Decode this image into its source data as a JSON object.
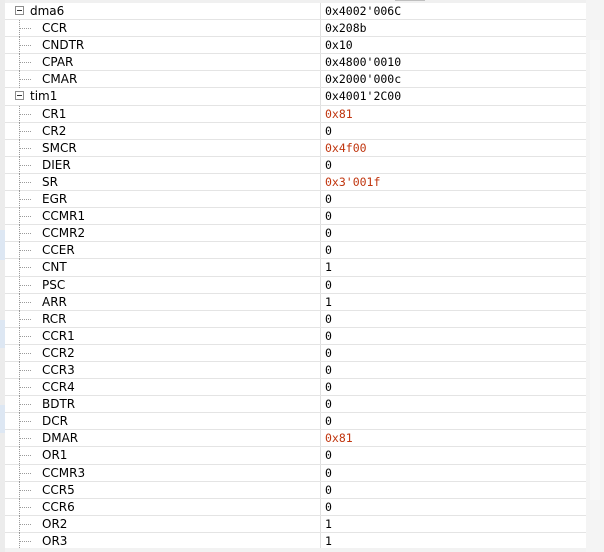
{
  "groups": [
    {
      "name": "dma6",
      "value": "0x4002'006C",
      "registers": [
        {
          "name": "CCR",
          "value": "0x208b",
          "changed": false
        },
        {
          "name": "CNDTR",
          "value": "0x10",
          "changed": false
        },
        {
          "name": "CPAR",
          "value": "0x4800'0010",
          "changed": false
        },
        {
          "name": "CMAR",
          "value": "0x2000'000c",
          "changed": false
        }
      ]
    },
    {
      "name": "tim1",
      "value": "0x4001'2C00",
      "registers": [
        {
          "name": "CR1",
          "value": "0x81",
          "changed": true
        },
        {
          "name": "CR2",
          "value": "0",
          "changed": false
        },
        {
          "name": "SMCR",
          "value": "0x4f00",
          "changed": true
        },
        {
          "name": "DIER",
          "value": "0",
          "changed": false
        },
        {
          "name": "SR",
          "value": "0x3'001f",
          "changed": true
        },
        {
          "name": "EGR",
          "value": "0",
          "changed": false
        },
        {
          "name": "CCMR1",
          "value": "0",
          "changed": false
        },
        {
          "name": "CCMR2",
          "value": "0",
          "changed": false
        },
        {
          "name": "CCER",
          "value": "0",
          "changed": false
        },
        {
          "name": "CNT",
          "value": "1",
          "changed": false
        },
        {
          "name": "PSC",
          "value": "0",
          "changed": false
        },
        {
          "name": "ARR",
          "value": "1",
          "changed": false
        },
        {
          "name": "RCR",
          "value": "0",
          "changed": false
        },
        {
          "name": "CCR1",
          "value": "0",
          "changed": false
        },
        {
          "name": "CCR2",
          "value": "0",
          "changed": false
        },
        {
          "name": "CCR3",
          "value": "0",
          "changed": false
        },
        {
          "name": "CCR4",
          "value": "0",
          "changed": false
        },
        {
          "name": "BDTR",
          "value": "0",
          "changed": false
        },
        {
          "name": "DCR",
          "value": "0",
          "changed": false
        },
        {
          "name": "DMAR",
          "value": "0x81",
          "changed": true
        },
        {
          "name": "OR1",
          "value": "0",
          "changed": false
        },
        {
          "name": "CCMR3",
          "value": "0",
          "changed": false
        },
        {
          "name": "CCR5",
          "value": "0",
          "changed": false
        },
        {
          "name": "CCR6",
          "value": "0",
          "changed": false
        },
        {
          "name": "OR2",
          "value": "1",
          "changed": false
        },
        {
          "name": "OR3",
          "value": "1",
          "changed": false
        }
      ]
    }
  ],
  "colors": {
    "changed_value": "#c0350e",
    "normal_value": "#000000"
  },
  "icons": {
    "group_toggle": "collapse-minus-icon"
  }
}
